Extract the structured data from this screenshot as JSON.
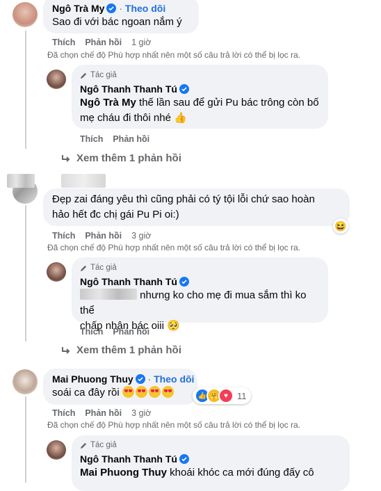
{
  "comments": {
    "c1": {
      "name": "Ngô Trà My",
      "follow": "Theo dõi",
      "text": "Sao đi với bác ngoan nắm ý",
      "like": "Thích",
      "reply": "Phản hồi",
      "time": "1 giờ"
    },
    "c1_note": "Đã chọn chế độ Phù hợp nhất nên một số câu trả lời có thể bị lọc ra.",
    "r1": {
      "tag": "Tác giả",
      "name": "Ngô Thanh Thanh Tú",
      "mention": "Ngô Trà My",
      "text_a": " thế lần sau để gửi Pu bác trông còn bố",
      "text_b": "mẹ cháu đi thôi nhé",
      "like": "Thích",
      "reply": "Phản hồi"
    },
    "more1": "Xem thêm 1 phản hồi",
    "c2": {
      "text_a": "Đẹp zai đáng yêu thì cũng phải có tý tội lỗi chứ sao hoàn",
      "text_b": "hảo hết đc chị gái Pu Pi oi:)",
      "like": "Thích",
      "reply": "Phản hồi",
      "time": "3 giờ"
    },
    "c2_note": "Đã chọn chế độ Phù hợp nhất nên một số câu trả lời có thể bị lọc ra.",
    "r2": {
      "tag": "Tác giả",
      "name": "Ngô Thanh Thanh Tú",
      "text_a": " nhưng ko cho mẹ đi mua sắm thì ko thể",
      "text_b": "chấp nhận bác oiii",
      "like": "Thích",
      "reply": "Phản hồi"
    },
    "more2": "Xem thêm 1 phản hồi",
    "c3": {
      "name": "Mai Phuong Thuy",
      "follow": "Theo dõi",
      "text": "soái ca đây rồi",
      "like": "Thích",
      "reply": "Phản hồi",
      "time": "3 giờ",
      "reaction_count": "11"
    },
    "c3_note": "Đã chọn chế độ Phù hợp nhất nên một số câu trả lời có thể bị lọc ra.",
    "r3": {
      "tag": "Tác giả",
      "name": "Ngô Thanh Thanh Tú",
      "mention": "Mai Phuong Thuy",
      "text": " khoái khóc ca mới đúng đấy cô"
    }
  },
  "colors": {
    "bubble": "#f0f2f5",
    "link": "#216fdb",
    "muted": "#65676b",
    "verified": "#1877f2"
  }
}
